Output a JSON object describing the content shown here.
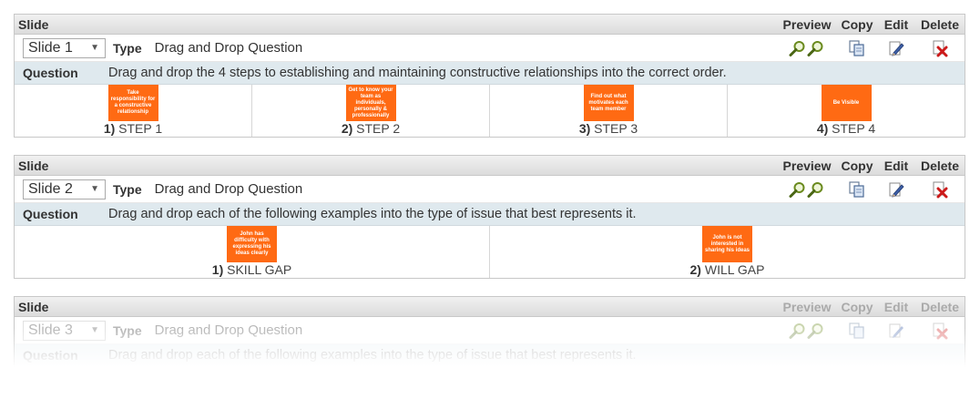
{
  "columns": {
    "slide": "Slide",
    "preview": "Preview",
    "copy": "Copy",
    "edit": "Edit",
    "delete": "Delete"
  },
  "type_label": "Type",
  "question_label": "Question",
  "colors": {
    "card": "#ff6a13",
    "question_bg": "#dfe9ee"
  },
  "slides": [
    {
      "selected": "Slide 1",
      "type": "Drag and Drop Question",
      "question": "Drag and drop the 4 steps to establishing and maintaining constructive relationships into the correct order.",
      "items": [
        {
          "num": "1)",
          "label": "STEP 1",
          "card_text": "Take responsibility for a constructive relationship"
        },
        {
          "num": "2)",
          "label": "STEP 2",
          "card_text": "Get to know your team as individuals, personally & professionally"
        },
        {
          "num": "3)",
          "label": "STEP 3",
          "card_text": "Find out what motivates each team member"
        },
        {
          "num": "4)",
          "label": "STEP 4",
          "card_text": "Be Visible"
        }
      ]
    },
    {
      "selected": "Slide 2",
      "type": "Drag and Drop Question",
      "question": "Drag and drop each of the following examples into the type of issue that best represents it.",
      "items": [
        {
          "num": "1)",
          "label": "SKILL GAP",
          "card_text": "John has difficulty with expressing his ideas clearly"
        },
        {
          "num": "2)",
          "label": "WILL GAP",
          "card_text": "John is not interested in sharing his ideas"
        }
      ]
    },
    {
      "selected": "Slide 3",
      "type": "Drag and Drop Question",
      "question": "Drag and drop each of the following examples into the type of issue that best represents it."
    }
  ],
  "icons": {
    "preview": [
      "magnify-icon",
      "magnify-icon"
    ],
    "copy": "copy-pages-icon",
    "edit": "pencil-icon",
    "delete": "delete-x-icon"
  }
}
